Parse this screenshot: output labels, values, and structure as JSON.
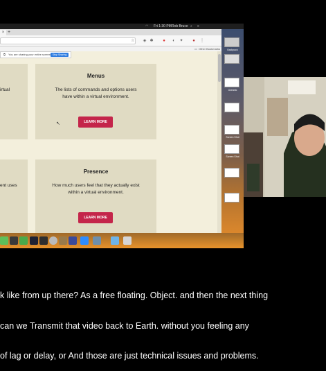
{
  "menubar": {
    "app_labels": [
      "Rob Bruce"
    ],
    "time": "Fri 1:30 PM"
  },
  "browser": {
    "newtab_glyph": "+",
    "sharing_notice": "You are sharing your entire screen.",
    "stop_sharing_label": "Stop Sharing",
    "bookmarks_right": "Other Bookmarks",
    "cards": [
      {
        "title": "",
        "description": "irtual",
        "button": ""
      },
      {
        "title": "Menus",
        "description": "The lists of commands and options users\nhave within a virtual environment.",
        "button": "LEARN MORE"
      },
      {
        "title": "",
        "description": "ent uses",
        "button": ""
      },
      {
        "title": "Presence",
        "description": "How much users feel that they actually exist\nwithin a virtual environment.",
        "button": "LEARN MORE"
      }
    ]
  },
  "desktop": {
    "icons": [
      "Backpack",
      "",
      "Oceanic",
      "",
      "",
      "Screen Shot",
      "Screen Shot",
      "",
      ""
    ]
  },
  "colors": {
    "accent": "#c4254a",
    "page_bg": "#f3efdc",
    "card_bg": "#e0dbc3"
  },
  "captions": {
    "line1": "k like from up there? As a free floating. Object. and then the next thing",
    "line2": "can we Transmit that video back to Earth. without you feeling any",
    "line3": "of lag or delay, or And those are just technical issues and problems."
  }
}
